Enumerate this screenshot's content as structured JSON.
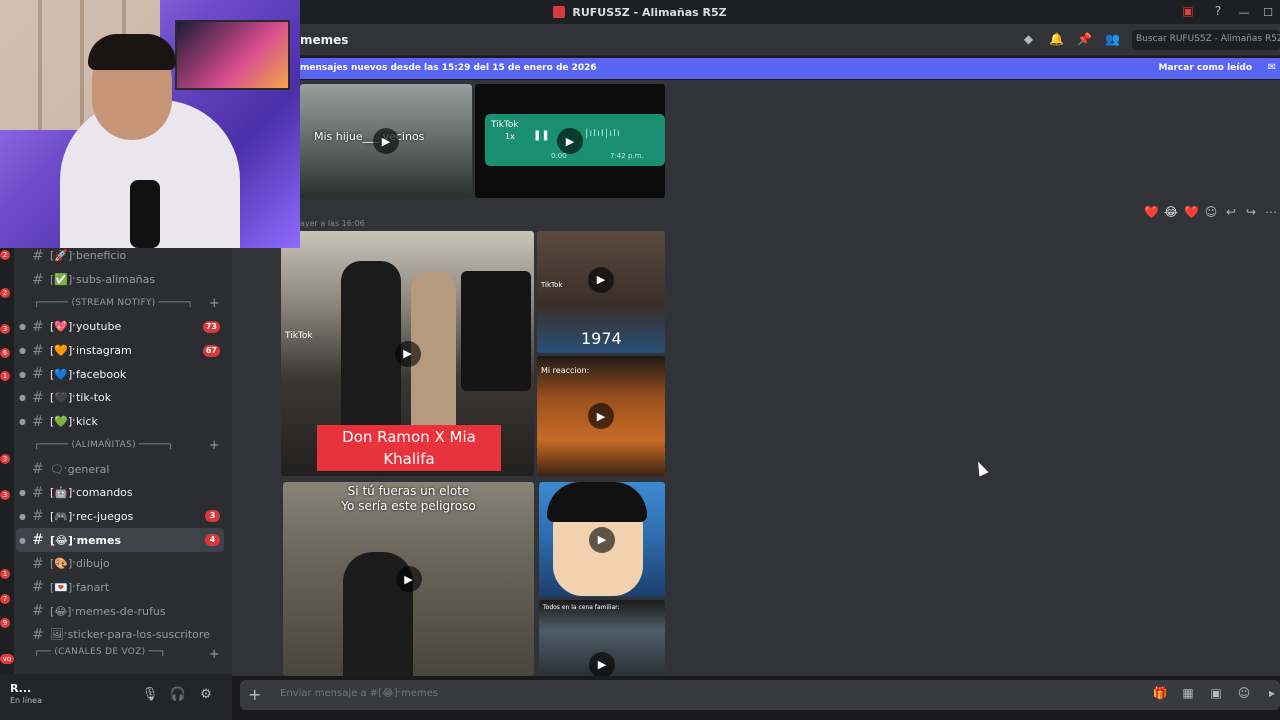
{
  "window": {
    "title": "RUFUS5Z - Alimañas R5Z",
    "controls": [
      "—",
      "☐"
    ]
  },
  "header": {
    "channel_name": "memes",
    "search_placeholder": "Buscar RUFUS5Z - Alimañas R5Z",
    "icons": [
      "threads-icon",
      "bell-icon",
      "pin-icon",
      "members-icon"
    ]
  },
  "banner": {
    "text": "mensajes nuevos desde las 15:29 del 15 de enero de 2026",
    "mark_read": "Marcar como leído"
  },
  "sidebar": {
    "channels": [
      {
        "label": "[🚀]ˑbeneficio",
        "type": "channel"
      },
      {
        "label": "[✅]ˑsubs-alimañas",
        "type": "channel"
      },
      {
        "label": "┌───── (STREAM NOTIFY) ─────┐",
        "type": "category"
      },
      {
        "label": "[💖]ˑyoutube",
        "type": "channel",
        "badge": "73",
        "bright": true
      },
      {
        "label": "[🧡]ˑinstagram",
        "type": "channel",
        "badge": "67",
        "bright": true
      },
      {
        "label": "[💙]ˑfacebook",
        "type": "channel",
        "bright": true
      },
      {
        "label": "[🖤]ˑtik-tok",
        "type": "channel",
        "bright": true
      },
      {
        "label": "[💚]ˑkick",
        "type": "channel",
        "bright": true
      },
      {
        "label": "┌───── (ALIMAÑITAS) ─────┐",
        "type": "category"
      },
      {
        "label": "🗨ˑgeneral",
        "type": "channel"
      },
      {
        "label": "[🤖]ˑcomandos",
        "type": "channel",
        "bright": true
      },
      {
        "label": "[🎮]ˑrec-juegos",
        "type": "channel",
        "badge": "3",
        "bright": true
      },
      {
        "label": "[😂]ˑmemes",
        "type": "channel",
        "badge": "4",
        "selected": true
      },
      {
        "label": "[🎨]ˑdibujo",
        "type": "channel"
      },
      {
        "label": "[💌]ˑfanart",
        "type": "channel"
      },
      {
        "label": "[😂]ˑmemes-de-rufus",
        "type": "channel"
      },
      {
        "label": "🖼ˑsticker-para-los-suscritores...",
        "type": "channel"
      },
      {
        "label": "┌── (CANALES DE VOZ) ──┐",
        "type": "category"
      }
    ]
  },
  "user": {
    "name": "R...",
    "status": "En línea"
  },
  "messages": {
    "timestamp": "ayer a las 16:06",
    "reactions": [
      "❤️",
      "😂",
      "❤️"
    ],
    "captions": {
      "vid1": "Mis hijue___ vecinos",
      "vid2_speed": "1x",
      "vid2_time_left": "0:00",
      "vid2_time_right": "7:42 p.m.",
      "tiktok": "TikTok",
      "don_ramon": "Don Ramon X Mia Khalifa",
      "year": "1974",
      "mi_reaccion": "Mi reaccion:",
      "elote": "Si tú fueras un elote\nYo sería este peligroso",
      "cena": "Todos en la cena familiar:"
    }
  },
  "composer": {
    "placeholder": "Enviar mensaje a #[😂]ˑmemes"
  },
  "colors": {
    "accent": "#5865f2",
    "badge": "#da373c",
    "bg_chat": "#313338",
    "bg_sidebar": "#2b2d31"
  }
}
